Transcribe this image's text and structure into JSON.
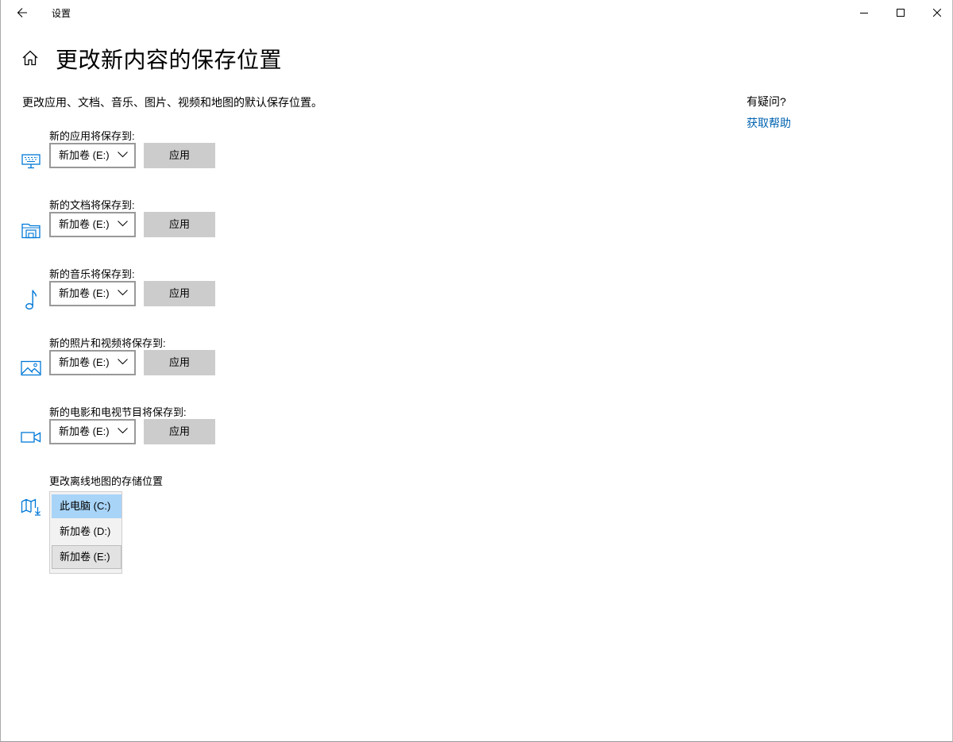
{
  "window": {
    "title": "设置"
  },
  "header": {
    "page_title": "更改新内容的保存位置",
    "description": "更改应用、文档、音乐、图片、视频和地图的默认保存位置。"
  },
  "help": {
    "question": "有疑问?",
    "link": "获取帮助"
  },
  "sections": [
    {
      "label": "新的应用将保存到:",
      "icon": "monitor-icon",
      "selected": "新加卷 (E:)",
      "apply_label": "应用"
    },
    {
      "label": "新的文档将保存到:",
      "icon": "documents-folder-icon",
      "selected": "新加卷 (E:)",
      "apply_label": "应用"
    },
    {
      "label": "新的音乐将保存到:",
      "icon": "music-note-icon",
      "selected": "新加卷 (E:)",
      "apply_label": "应用"
    },
    {
      "label": "新的照片和视频将保存到:",
      "icon": "picture-icon",
      "selected": "新加卷 (E:)",
      "apply_label": "应用"
    },
    {
      "label": "新的电影和电视节目将保存到:",
      "icon": "video-camera-icon",
      "selected": "新加卷 (E:)",
      "apply_label": "应用"
    }
  ],
  "maps": {
    "label": "更改离线地图的存储位置",
    "icon": "map-download-icon",
    "options": [
      "此电脑 (C:)",
      "新加卷 (D:)",
      "新加卷 (E:)"
    ],
    "highlighted_option": "此电脑 (C:)",
    "hovered_option": "新加卷 (E:)"
  },
  "colors": {
    "accent": "#0063b1",
    "icon": "#0078d7",
    "button": "#cccccc",
    "selection": "#a8d4f8"
  }
}
